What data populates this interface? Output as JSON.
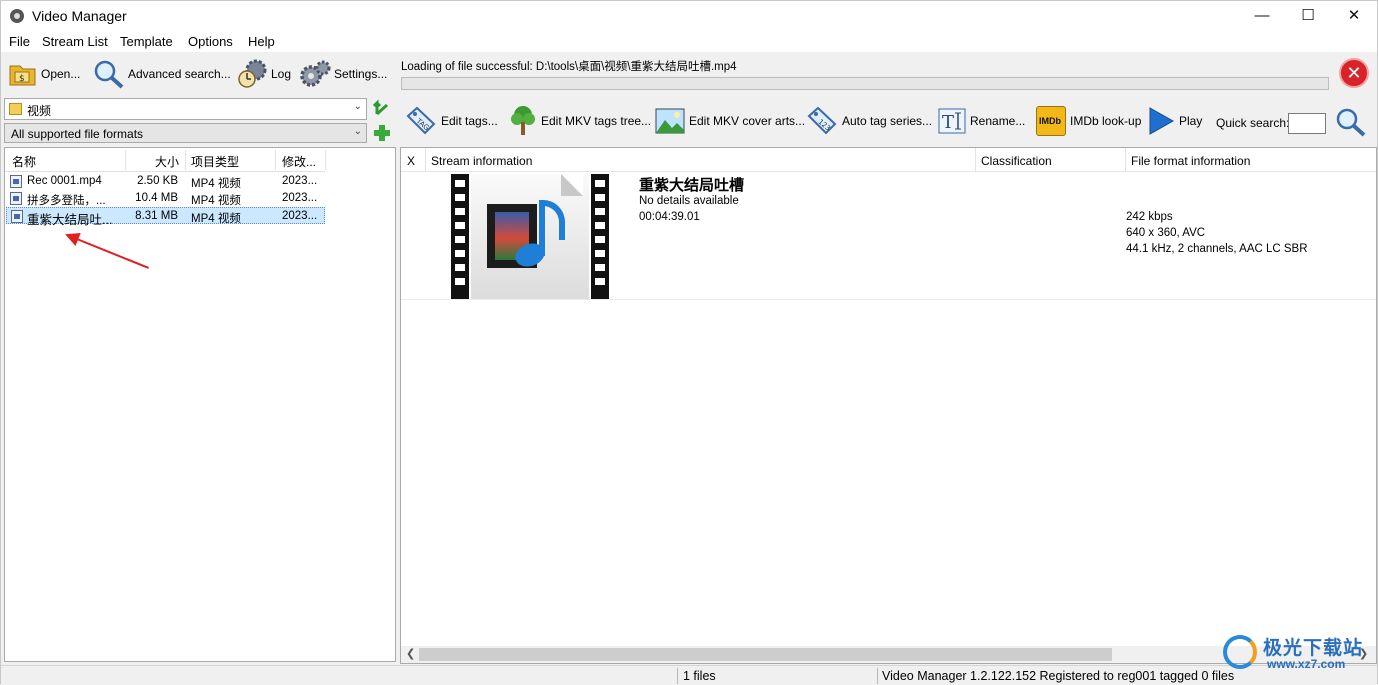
{
  "window": {
    "title": "Video Manager",
    "minimize": "—",
    "maximize": "☐",
    "close": "✕"
  },
  "menu": [
    "File",
    "Stream List",
    "Template",
    "Options",
    "Help"
  ],
  "left_toolbar": {
    "open": "Open...",
    "advanced_search": "Advanced search...",
    "log": "Log",
    "settings": "Settings..."
  },
  "folder": {
    "value": "视频",
    "filter": "All supported file formats"
  },
  "file_list": {
    "columns": [
      "名称",
      "大小",
      "项目类型",
      "修改..."
    ],
    "rows": [
      {
        "name": "Rec 0001.mp4",
        "size": "2.50 KB",
        "type": "MP4 视频",
        "modified": "2023..."
      },
      {
        "name": "拼多多登陆，...",
        "size": "10.4 MB",
        "type": "MP4 视频",
        "modified": "2023..."
      },
      {
        "name": "重紫大结局吐...",
        "size": "8.31 MB",
        "type": "MP4 视频",
        "modified": "2023..."
      }
    ]
  },
  "status": {
    "message": "Loading of file successful: D:\\tools\\桌面\\视频\\重紫大结局吐槽.mp4",
    "progress": 0
  },
  "right_toolbar": {
    "edit_tags": "Edit tags...",
    "edit_mkv_tree": "Edit MKV tags tree...",
    "edit_mkv_cover": "Edit MKV cover arts...",
    "auto_tag": "Auto tag series...",
    "rename": "Rename...",
    "imdb": "IMDb look-up",
    "imdb_badge": "IMDb",
    "play": "Play",
    "quick_search_label": "Quick search:",
    "quick_search_value": ""
  },
  "detail": {
    "columns": [
      "X",
      "Stream information",
      "Classification",
      "File format information"
    ],
    "stream_title": "重紫大结局吐槽",
    "stream_details": "No details available",
    "stream_duration": "00:04:39.01",
    "format_lines": [
      "242 kbps",
      "640 x 360, AVC",
      "44.1 kHz, 2 channels, AAC LC SBR"
    ]
  },
  "statusbar": {
    "files": "1 files",
    "info": "Video Manager 1.2.122.152 Registered to reg001 tagged 0 files"
  },
  "watermark": {
    "text": "极光下载站",
    "url": "www.xz7.com"
  },
  "colors": {
    "accent": "#1f7fd6",
    "danger": "#d8232a",
    "arrow": "#e02020"
  }
}
